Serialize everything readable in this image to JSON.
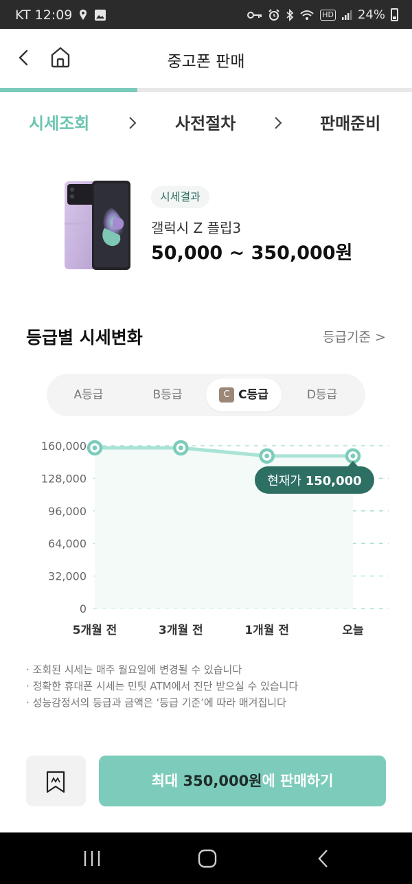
{
  "status_bar": {
    "carrier_time": "KT 12:09",
    "hd_label": "HD",
    "battery": "24%",
    "icons": [
      "location-icon",
      "image-icon",
      "key-icon",
      "alarm-icon",
      "bluetooth-icon",
      "wifi-icon",
      "signal-icon",
      "battery-icon"
    ]
  },
  "header": {
    "title": "중고폰 판매"
  },
  "progress": {
    "fraction": 0.333
  },
  "steps": [
    "시세조회",
    "사전절차",
    "판매준비"
  ],
  "product": {
    "badge": "시세결과",
    "name": "갤럭시 Z 플립3",
    "price_range": "50,000 ~ 350,000원"
  },
  "section": {
    "title": "등급별 시세변화",
    "grade_link": "등급기준 >"
  },
  "grade_tabs": {
    "tabs": [
      "A등급",
      "B등급",
      "C등급",
      "D등급"
    ],
    "active_index": 2,
    "active_badge": "C"
  },
  "chart_data": {
    "type": "line",
    "categories": [
      "5개월 전",
      "3개월 전",
      "1개월 전",
      "오늘"
    ],
    "values": [
      158000,
      158000,
      150000,
      150000
    ],
    "y_ticks": [
      "160,000",
      "128,000",
      "96,000",
      "64,000",
      "32,000",
      "0"
    ],
    "ylim": [
      0,
      160000
    ],
    "grid": "dashed horizontal",
    "callout": {
      "label": "현재가",
      "value": "150,000"
    },
    "colors": {
      "line": "#a9e3d6",
      "point": "#7ccbbb",
      "area": "#f3faf8",
      "callout": "#2e6f64",
      "grid": "#9fddd0"
    }
  },
  "notes": [
    "· 조회된 시세는 매주 월요일에 변경될 수 있습니다",
    "· 정확한 휴대폰 시세는 민팃 ATM에서 진단 받으실 수 있습니다",
    "· 성능감정서의 등급과 금액은 ‘등급 기준’에 따라 매겨집니다"
  ],
  "bottom": {
    "sell_prefix": "최대 ",
    "sell_amount": "350,000원",
    "sell_suffix": "에 판매하기"
  },
  "colors": {
    "accent": "#7ccbbb",
    "step_active": "#6cc5b2"
  }
}
